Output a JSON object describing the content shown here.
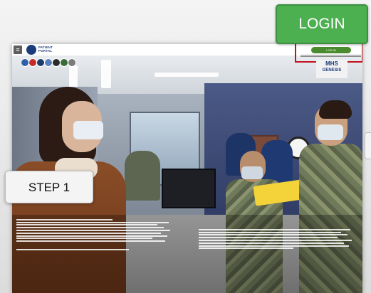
{
  "callouts": {
    "login_label": "LOGIN",
    "step_label": "STEP 1"
  },
  "site": {
    "menu_icon": "hamburger-icon",
    "logo_text_line1": "PATIENT",
    "logo_text_line2": "PORTAL",
    "login_button_label": "LOG IN",
    "mhs_logo_line1": "MHS",
    "mhs_logo_line2": "GENESIS"
  },
  "colors": {
    "login_callout": "#4caf50",
    "login_highlight_border": "#c0111f",
    "site_login_button": "#4b8b2f",
    "step_callout": "#f4f4f4"
  }
}
